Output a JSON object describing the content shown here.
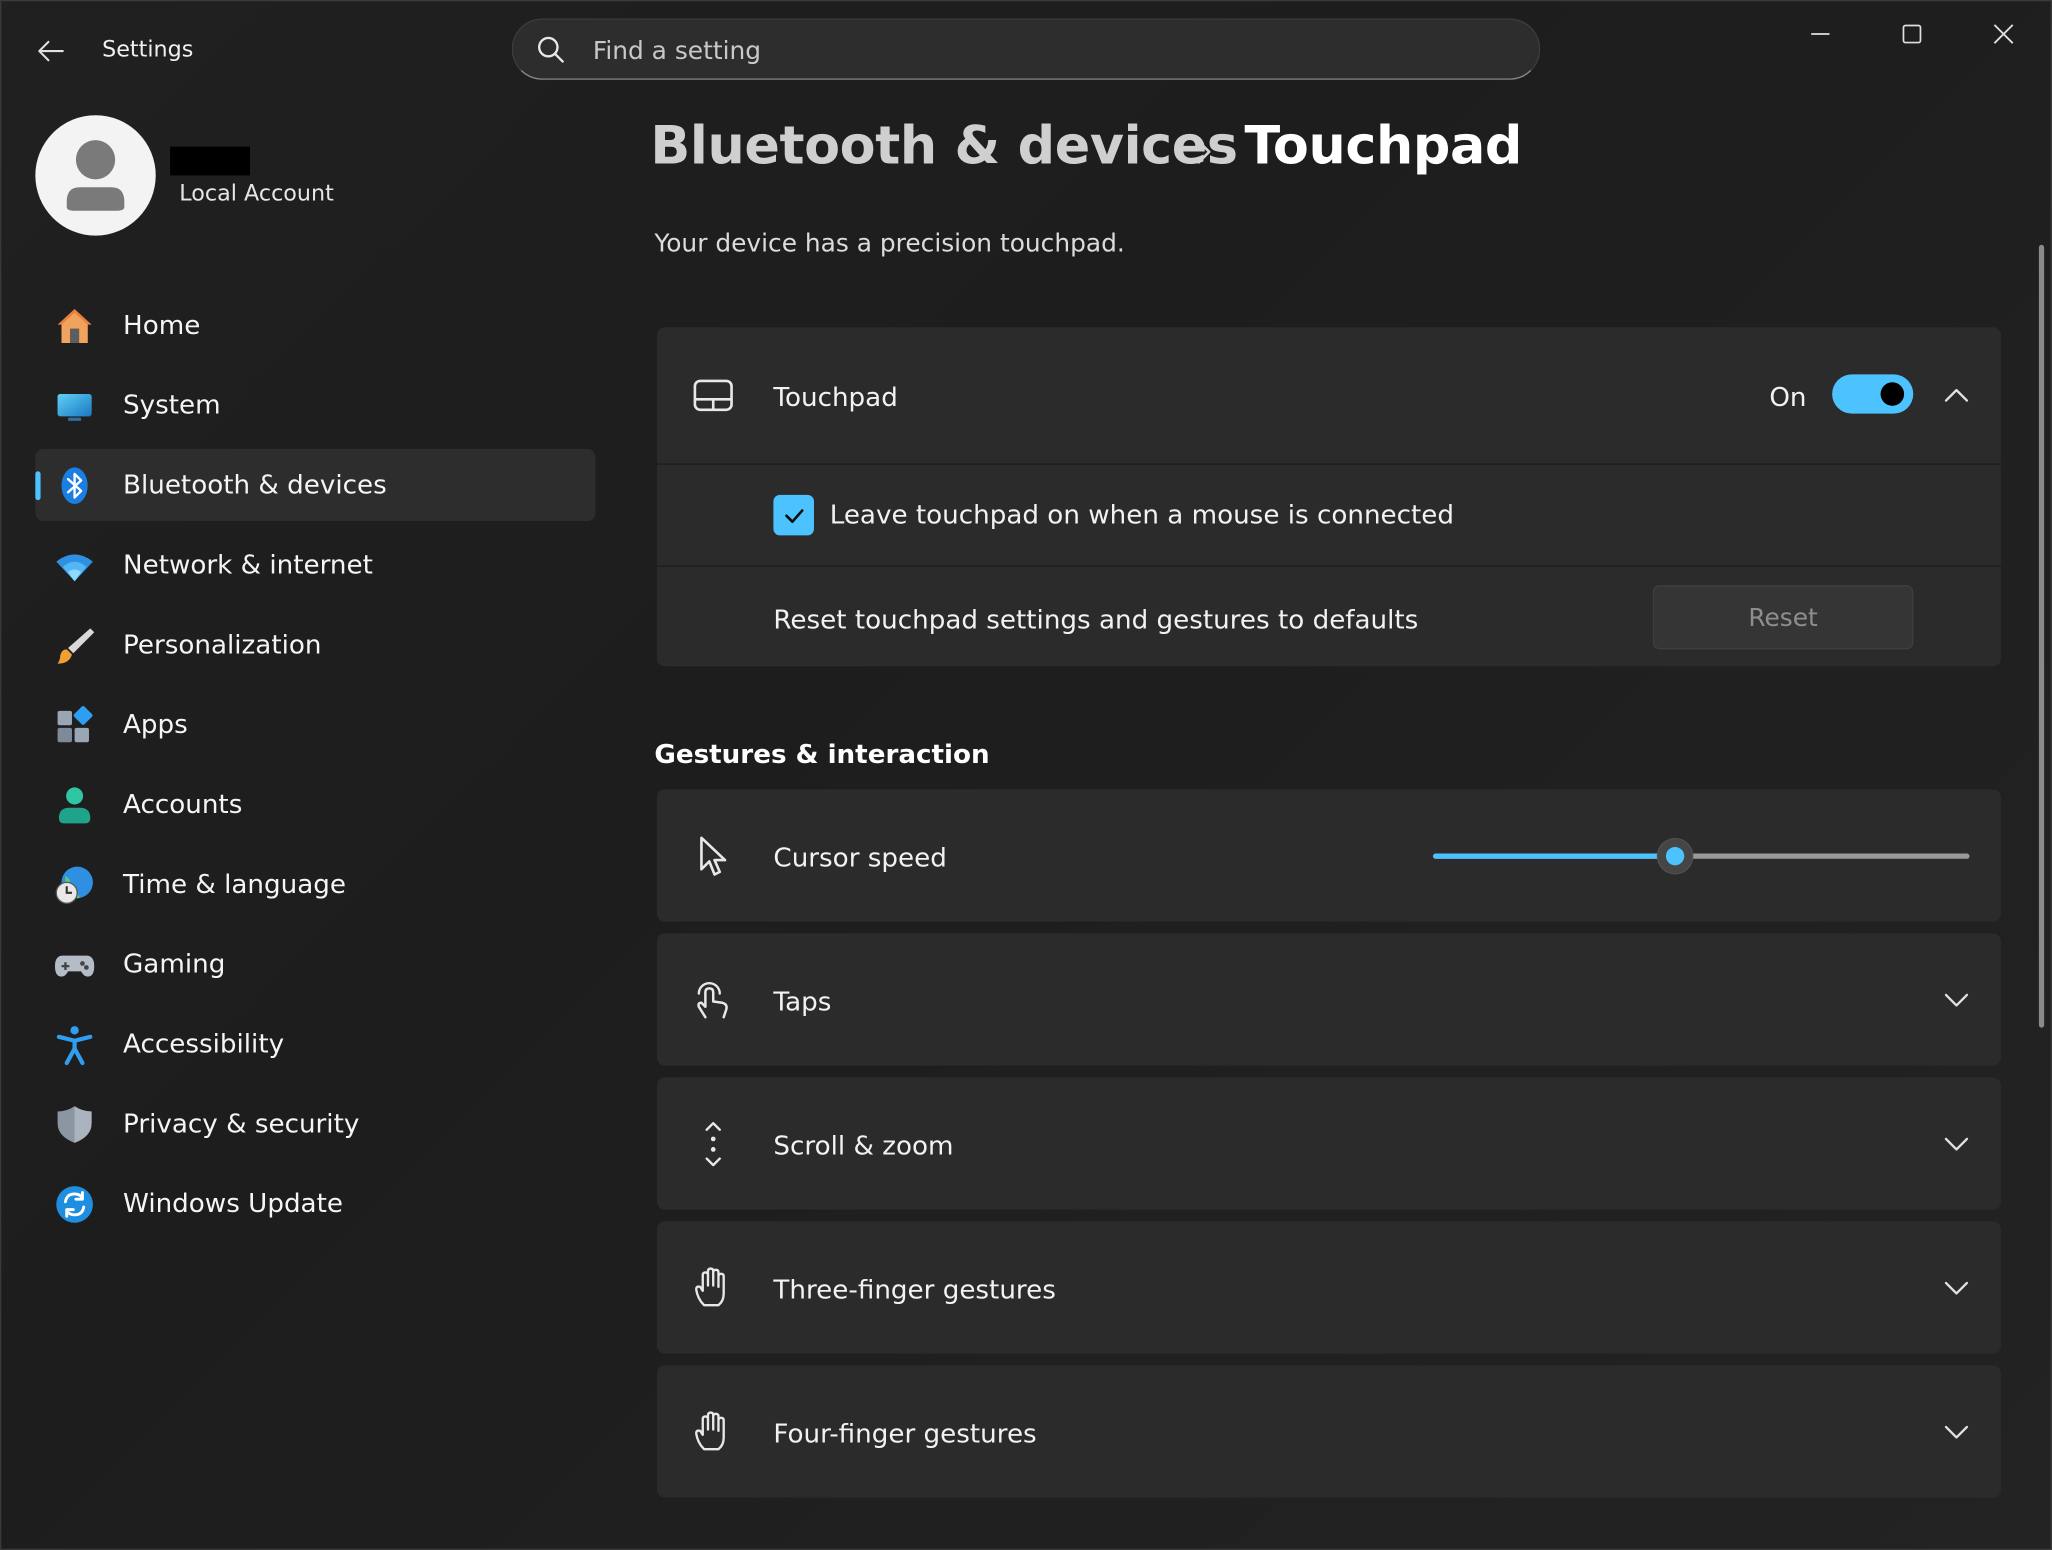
{
  "window": {
    "app_title": "Settings",
    "controls": {
      "minimize": "minimize-icon",
      "maximize": "maximize-icon",
      "close": "close-icon"
    }
  },
  "search": {
    "placeholder": "Find a setting",
    "value": ""
  },
  "profile": {
    "account_type": "Local Account"
  },
  "sidebar": {
    "items": [
      {
        "label": "Home",
        "icon": "home-icon"
      },
      {
        "label": "System",
        "icon": "system-icon"
      },
      {
        "label": "Bluetooth & devices",
        "icon": "bluetooth-icon",
        "selected": true
      },
      {
        "label": "Network & internet",
        "icon": "wifi-icon"
      },
      {
        "label": "Personalization",
        "icon": "brush-icon"
      },
      {
        "label": "Apps",
        "icon": "apps-icon"
      },
      {
        "label": "Accounts",
        "icon": "accounts-icon"
      },
      {
        "label": "Time & language",
        "icon": "globe-clock-icon"
      },
      {
        "label": "Gaming",
        "icon": "gamepad-icon"
      },
      {
        "label": "Accessibility",
        "icon": "accessibility-icon"
      },
      {
        "label": "Privacy & security",
        "icon": "shield-icon"
      },
      {
        "label": "Windows Update",
        "icon": "update-icon"
      }
    ]
  },
  "header": {
    "breadcrumb_parent": "Bluetooth & devices",
    "title": "Touchpad",
    "subtitle": "Your device has a precision touchpad."
  },
  "touchpad": {
    "label": "Touchpad",
    "state_label": "On",
    "enabled": true,
    "expanded": true,
    "leave_on_label": "Leave touchpad on when a mouse is connected",
    "leave_on_checked": true,
    "reset_label": "Reset touchpad settings and gestures to defaults",
    "reset_button": "Reset"
  },
  "gestures": {
    "heading": "Gestures & interaction",
    "cursor_speed": {
      "label": "Cursor speed",
      "value_fraction": 0.45
    },
    "sections": [
      {
        "label": "Taps",
        "icon": "tap-icon"
      },
      {
        "label": "Scroll & zoom",
        "icon": "scroll-icon"
      },
      {
        "label": "Three-finger gestures",
        "icon": "hand-icon"
      },
      {
        "label": "Four-finger gestures",
        "icon": "hand-icon"
      }
    ]
  },
  "colors": {
    "accent": "#4cc2ff",
    "background": "#202020",
    "card": "#2b2b2b"
  }
}
